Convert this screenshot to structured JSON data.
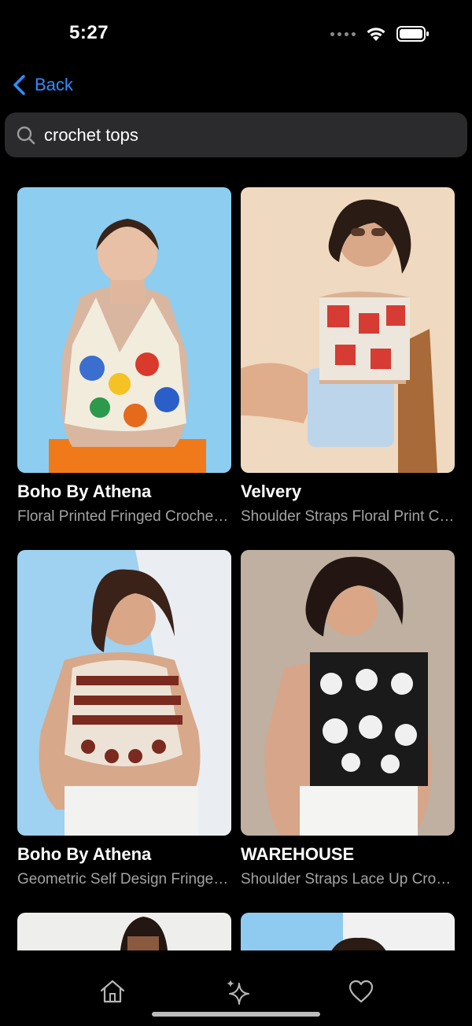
{
  "status_bar": {
    "time": "5:27"
  },
  "nav": {
    "back_label": "Back"
  },
  "search": {
    "value": "crochet tops",
    "placeholder": "crochet tops"
  },
  "products": [
    {
      "brand": "Boho By Athena",
      "description": "Floral Printed Fringed Crochet Crop Top"
    },
    {
      "brand": "Velvery",
      "description": "Shoulder Straps Floral Print Crochet Top"
    },
    {
      "brand": "Boho By Athena",
      "description": "Geometric Self Design Fringed Crop Top"
    },
    {
      "brand": "WAREHOUSE",
      "description": "Shoulder Straps Lace Up Crochet Top"
    }
  ],
  "tab_bar": {
    "items": [
      "home-icon",
      "sparkles-icon",
      "heart-icon"
    ]
  }
}
